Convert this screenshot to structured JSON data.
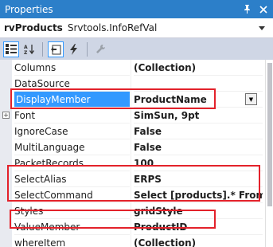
{
  "window": {
    "title": "Properties",
    "pin_icon": "pin-icon",
    "close_icon": "close-icon"
  },
  "object_selector": {
    "name": "rvProducts",
    "type": "Srvtools.InfoRefVal"
  },
  "toolbar": {
    "buttons": [
      {
        "icon": "categorized-icon",
        "glyph": "▦",
        "active": true
      },
      {
        "icon": "alphabetical-icon",
        "glyph": "↓",
        "active": false
      },
      {
        "icon": "properties-icon",
        "glyph": "⬚",
        "active": true
      },
      {
        "icon": "events-icon",
        "glyph": "ϟ",
        "active": false
      },
      {
        "icon": "property-pages-icon",
        "glyph": "🔧",
        "active": false,
        "disabled": true
      }
    ]
  },
  "properties": [
    {
      "name": "Columns",
      "value": "(Collection)",
      "expander": false,
      "selected": false
    },
    {
      "name": "DataSource",
      "value": "",
      "expander": false,
      "selected": false
    },
    {
      "name": "DisplayMember",
      "value": "ProductName",
      "expander": false,
      "selected": true
    },
    {
      "name": "Font",
      "value": "SimSun, 9pt",
      "expander": true,
      "selected": false
    },
    {
      "name": "IgnoreCase",
      "value": "False",
      "expander": false,
      "selected": false
    },
    {
      "name": "MultiLanguage",
      "value": "False",
      "expander": false,
      "selected": false
    },
    {
      "name": "PacketRecords",
      "value": "100",
      "expander": false,
      "selected": false
    },
    {
      "name": "SelectAlias",
      "value": "ERPS",
      "expander": false,
      "selected": false
    },
    {
      "name": "SelectCommand",
      "value": "Select [products].* From [",
      "expander": false,
      "selected": false
    },
    {
      "name": "Styles",
      "value": "gridStyle",
      "expander": false,
      "selected": false
    },
    {
      "name": "ValueMember",
      "value": "ProductID",
      "expander": false,
      "selected": false
    },
    {
      "name": "whereItem",
      "value": "(Collection)",
      "expander": false,
      "selected": false
    }
  ],
  "expander_glyph": "+",
  "dropdown_glyph": "▼",
  "colors": {
    "titlebar": "#2c7fc9",
    "selection": "#3399ff",
    "highlight_box": "#e3222b"
  }
}
